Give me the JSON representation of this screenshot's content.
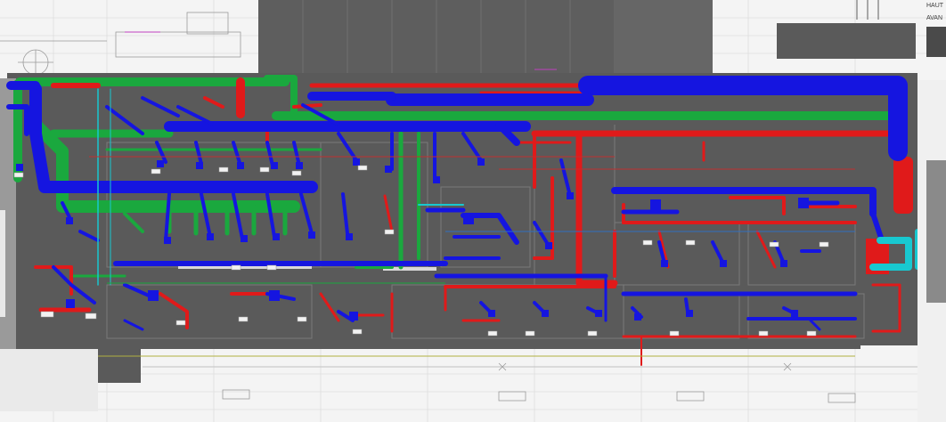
{
  "labels": {
    "top_right_a": "HAUT",
    "top_right_b": "AVAN"
  },
  "legend_colors": {
    "supply_duct": "#1515e0",
    "return_duct": "#e01818",
    "exhaust_duct": "#18a83c",
    "hot_water_pipe": "#e01818",
    "cyan_duct": "#18c8d0",
    "background_paper": "#f2f2f2",
    "floor_slab": "#5c5c5c"
  }
}
